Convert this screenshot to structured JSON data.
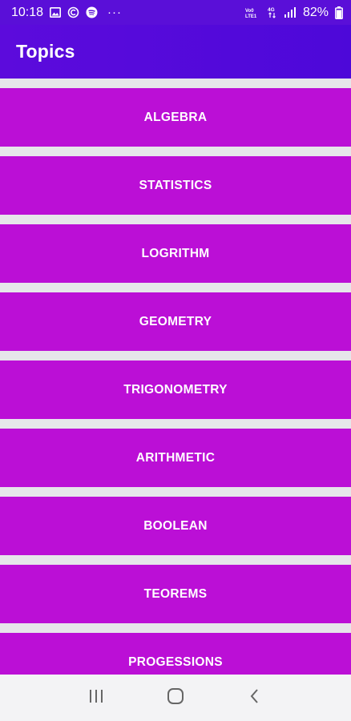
{
  "status_bar": {
    "time": "10:18",
    "battery": "82%",
    "more": "···",
    "icons": [
      "gallery-icon",
      "sync-icon",
      "spotify-icon",
      "volte-icon",
      "data-4g-icon",
      "signal-icon",
      "battery-icon"
    ]
  },
  "app_bar": {
    "title": "Topics"
  },
  "topics": [
    {
      "label": "ALGEBRA"
    },
    {
      "label": "STATISTICS"
    },
    {
      "label": "LOGRITHM"
    },
    {
      "label": "GEOMETRY"
    },
    {
      "label": "TRIGONOMETRY"
    },
    {
      "label": "ARITHMETIC"
    },
    {
      "label": "BOOLEAN"
    },
    {
      "label": "TEOREMS"
    },
    {
      "label": "PROGESSIONS"
    }
  ],
  "nav_bar": {
    "icons": [
      "recent-apps-icon",
      "home-icon",
      "back-icon"
    ]
  },
  "colors": {
    "status_bar": "#5a0fd8",
    "app_bar": "#5c0bdc",
    "topic_button": "#bb0fd6",
    "list_background": "#e6e6ea",
    "nav_bar": "#f3f3f5"
  }
}
